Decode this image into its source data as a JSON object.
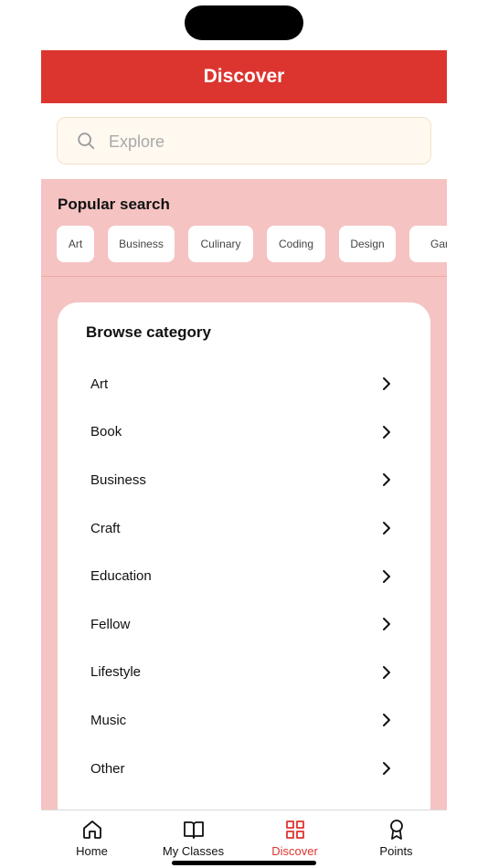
{
  "header": {
    "title": "Discover"
  },
  "search": {
    "placeholder": "Explore"
  },
  "popular": {
    "title": "Popular search",
    "chips": [
      "Art",
      "Business",
      "Culinary",
      "Coding",
      "Design",
      "Gam"
    ]
  },
  "browse": {
    "title": "Browse category",
    "items": [
      "Art",
      "Book",
      "Business",
      "Craft",
      "Education",
      "Fellow",
      "Lifestyle",
      "Music",
      "Other"
    ]
  },
  "tabbar": {
    "tabs": [
      {
        "label": "Home",
        "icon": "home-icon"
      },
      {
        "label": "My Classes",
        "icon": "book-icon"
      },
      {
        "label": "Discover",
        "icon": "grid-icon",
        "active": true
      },
      {
        "label": "Points",
        "icon": "award-icon"
      }
    ]
  },
  "colors": {
    "accent": "#dc3530",
    "panel": "#f5c3c2",
    "search_bg": "#fff9f0"
  }
}
